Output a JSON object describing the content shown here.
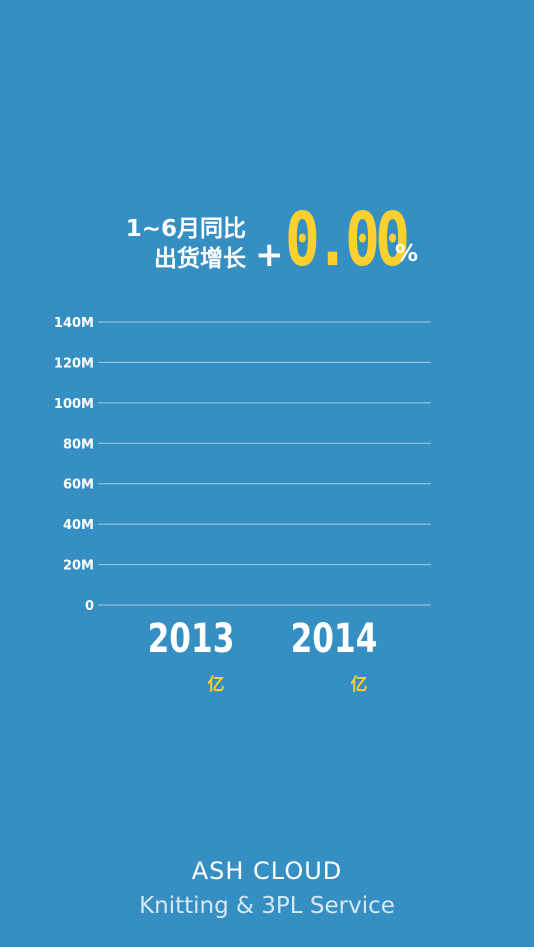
{
  "headline": {
    "label_line1": "1~6月同比",
    "label_line2": "出货增长",
    "sign": "+",
    "value": "0.00",
    "unit": "%"
  },
  "chart_data": {
    "type": "bar",
    "categories": [
      "2013",
      "2014"
    ],
    "values": [
      0,
      0
    ],
    "unit_labels": [
      "亿",
      "亿"
    ],
    "yticks": [
      "0",
      "20M",
      "40M",
      "60M",
      "80M",
      "100M",
      "120M",
      "140M"
    ],
    "ylim": [
      0,
      140000000
    ],
    "grid": true,
    "title": "",
    "xlabel": "",
    "ylabel": ""
  },
  "colors": {
    "background": "#358fc3",
    "accent": "#fcd02f",
    "text": "#ffffff",
    "grid": "#b9d6ea"
  },
  "footer": {
    "title": "ASH CLOUD",
    "subtitle": "Knitting & 3PL Service"
  }
}
